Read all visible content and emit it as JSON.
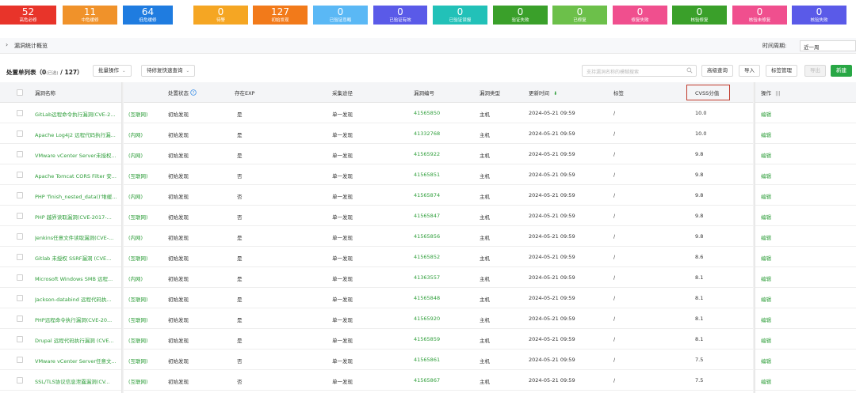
{
  "stat_tiles": [
    {
      "count": "52",
      "label": "高危必修",
      "color": "#e8342a"
    },
    {
      "count": "11",
      "label": "中危缓修",
      "color": "#f0922a"
    },
    {
      "count": "64",
      "label": "低危缓修",
      "color": "#1f7ce0"
    },
    {
      "count": "0",
      "label": "待警",
      "color": "#f5a623"
    },
    {
      "count": "127",
      "label": "初始发现",
      "color": "#f27a1a"
    },
    {
      "count": "0",
      "label": "已验证忽略",
      "color": "#5ab8f5"
    },
    {
      "count": "0",
      "label": "已验证有效",
      "color": "#5a5ae8"
    },
    {
      "count": "0",
      "label": "已验证误报",
      "color": "#22c1b8"
    },
    {
      "count": "0",
      "label": "验证失败",
      "color": "#3aa02a"
    },
    {
      "count": "0",
      "label": "已修复",
      "color": "#6cc04a"
    },
    {
      "count": "0",
      "label": "修复失败",
      "color": "#f04f8e"
    },
    {
      "count": "0",
      "label": "核验修复",
      "color": "#3aa02a"
    },
    {
      "count": "0",
      "label": "核验未修复",
      "color": "#f04f8e"
    },
    {
      "count": "0",
      "label": "核验失败",
      "color": "#5a5ae8"
    }
  ],
  "summary": {
    "title": "漏洞统计概览",
    "period_label": "时间周期:",
    "period_value": "近一周"
  },
  "toolbar": {
    "title": "处置单列表（0",
    "selected_label": "(已选)",
    "total": "/ 127）",
    "bulk_button": "批量操作",
    "quick_query_button": "待修复快速查询",
    "search_placeholder": "支持漏洞名称的模糊搜索",
    "advanced_button": "高级查询",
    "import_button": "导入",
    "tag_button": "标签管理",
    "export_button": "导出",
    "new_button": "新建"
  },
  "table": {
    "columns": [
      "漏洞名称",
      "处置状态",
      "存在EXP",
      "采集途径",
      "漏洞编号",
      "漏洞类型",
      "更新时间",
      "标签",
      "CVSS分值",
      "操作"
    ],
    "rows": [
      {
        "name": "GitLab远程命令执行漏洞(CVE-2021...",
        "network": "(互联网)",
        "status": "初始发现",
        "exp": "是",
        "source": "单一发现",
        "vuln_id": "41565850",
        "type": "主机",
        "updated": "2024-05-21 09:59",
        "tags": "/",
        "cvss": "10.0",
        "action": "编辑"
      },
      {
        "name": "Apache Log4j2 远程代码执行漏...",
        "network": "(内网)",
        "status": "初始发现",
        "exp": "是",
        "source": "单一发现",
        "vuln_id": "41332768",
        "type": "主机",
        "updated": "2024-05-21 09:59",
        "tags": "/",
        "cvss": "10.0",
        "action": "编辑"
      },
      {
        "name": "VMware vCenter Server未授权...",
        "network": "(内网)",
        "status": "初始发现",
        "exp": "是",
        "source": "单一发现",
        "vuln_id": "41565922",
        "type": "主机",
        "updated": "2024-05-21 09:59",
        "tags": "/",
        "cvss": "9.8",
        "action": "编辑"
      },
      {
        "name": "Apache Tomcat CORS Filter 安...",
        "network": "(互联网)",
        "status": "初始发现",
        "exp": "否",
        "source": "单一发现",
        "vuln_id": "41565851",
        "type": "主机",
        "updated": "2024-05-21 09:59",
        "tags": "/",
        "cvss": "9.8",
        "action": "编辑"
      },
      {
        "name": "PHP 'finish_nested_data()'堆缓...",
        "network": "(内网)",
        "status": "初始发现",
        "exp": "否",
        "source": "单一发现",
        "vuln_id": "41565874",
        "type": "主机",
        "updated": "2024-05-21 09:59",
        "tags": "/",
        "cvss": "9.8",
        "action": "编辑"
      },
      {
        "name": "PHP 越界读取漏洞(CVE-2017-...",
        "network": "(互联网)",
        "status": "初始发现",
        "exp": "否",
        "source": "单一发现",
        "vuln_id": "41565847",
        "type": "主机",
        "updated": "2024-05-21 09:59",
        "tags": "/",
        "cvss": "9.8",
        "action": "编辑"
      },
      {
        "name": "Jenkins任意文件读取漏洞(CVE-...",
        "network": "(内网)",
        "status": "初始发现",
        "exp": "是",
        "source": "单一发现",
        "vuln_id": "41565856",
        "type": "主机",
        "updated": "2024-05-21 09:59",
        "tags": "/",
        "cvss": "9.8",
        "action": "编辑"
      },
      {
        "name": "Gitlab 未授权 SSRF漏洞 (CVE...",
        "network": "(互联网)",
        "status": "初始发现",
        "exp": "是",
        "source": "单一发现",
        "vuln_id": "41565852",
        "type": "主机",
        "updated": "2024-05-21 09:59",
        "tags": "/",
        "cvss": "8.6",
        "action": "编辑"
      },
      {
        "name": "Microsoft Windows SMB 远程...",
        "network": "(内网)",
        "status": "初始发现",
        "exp": "是",
        "source": "单一发现",
        "vuln_id": "41363557",
        "type": "主机",
        "updated": "2024-05-21 09:59",
        "tags": "/",
        "cvss": "8.1",
        "action": "编辑"
      },
      {
        "name": "Jackson-databind 远程代码执...",
        "network": "(互联网)",
        "status": "初始发现",
        "exp": "是",
        "source": "单一发现",
        "vuln_id": "41565848",
        "type": "主机",
        "updated": "2024-05-21 09:59",
        "tags": "/",
        "cvss": "8.1",
        "action": "编辑"
      },
      {
        "name": "PHP远程命令执行漏洞(CVE-20...",
        "network": "(互联网)",
        "status": "初始发现",
        "exp": "是",
        "source": "单一发现",
        "vuln_id": "41565920",
        "type": "主机",
        "updated": "2024-05-21 09:59",
        "tags": "/",
        "cvss": "8.1",
        "action": "编辑"
      },
      {
        "name": "Drupal 远程代码执行漏洞 (CVE...",
        "network": "(互联网)",
        "status": "初始发现",
        "exp": "是",
        "source": "单一发现",
        "vuln_id": "41565859",
        "type": "主机",
        "updated": "2024-05-21 09:59",
        "tags": "/",
        "cvss": "8.1",
        "action": "编辑"
      },
      {
        "name": "VMware vCenter Server任意文...",
        "network": "(互联网)",
        "status": "初始发现",
        "exp": "否",
        "source": "单一发现",
        "vuln_id": "41565861",
        "type": "主机",
        "updated": "2024-05-21 09:59",
        "tags": "/",
        "cvss": "7.5",
        "action": "编辑"
      },
      {
        "name": "SSL/TLS协议信息泄露漏洞(CV...",
        "network": "(互联网)",
        "status": "初始发现",
        "exp": "否",
        "source": "单一发现",
        "vuln_id": "41565867",
        "type": "主机",
        "updated": "2024-05-21 09:59",
        "tags": "/",
        "cvss": "7.5",
        "action": "编辑"
      }
    ]
  }
}
